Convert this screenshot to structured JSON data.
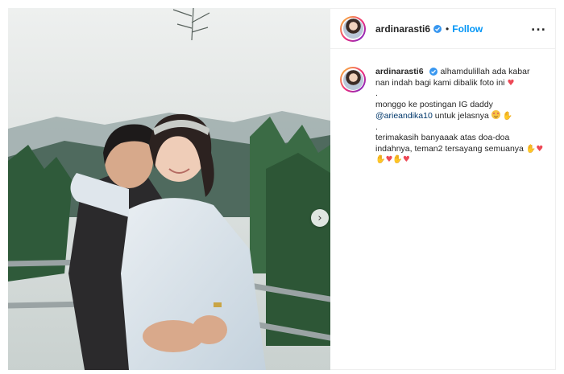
{
  "post": {
    "username": "ardinarasti6",
    "follow_label": "Follow",
    "more_label": "...",
    "separator": "•"
  },
  "caption": {
    "username": "ardinarasti6",
    "line1": "alhamdulillah ada kabar nan indah bagi kami dibalik foto ini",
    "dot1": ".",
    "line2_prefix": "monggo ke postingan IG daddy",
    "mention": "@arieandika10",
    "line2_suffix": "untuk jelasnya",
    "dot2": ".",
    "line3": "terimakasih banyaaak atas doa-doa indahnya, teman2 tersayang semuanya"
  },
  "icons": {
    "verified": "verified-badge-icon",
    "next": "chevron-right-icon",
    "heart": "red-heart-emoji",
    "pray": "folded-hands-emoji",
    "smile": "smiling-face-with-hearts-emoji"
  },
  "colors": {
    "follow": "#0095f6",
    "verified": "#3897f0",
    "heart": "#ed4956",
    "mention": "#00376b"
  }
}
